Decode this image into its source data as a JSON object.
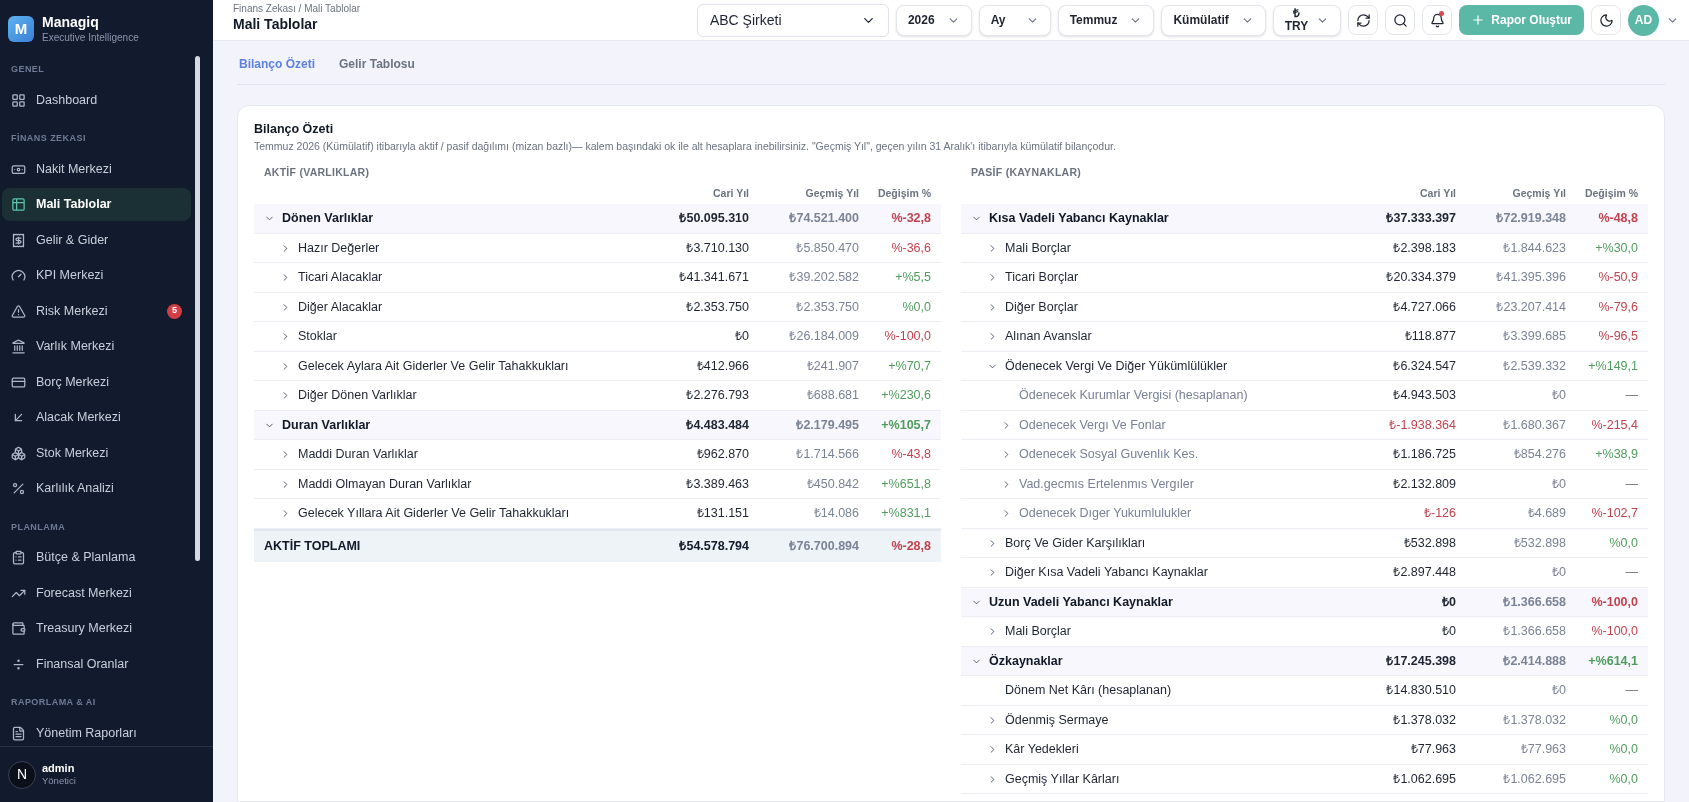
{
  "brand": {
    "logo_letter": "M",
    "name": "Managiq",
    "tagline": "Executive Intelligence"
  },
  "sidebar": {
    "sections": [
      {
        "label": "GENEL",
        "items": [
          {
            "label": "Dashboard",
            "selected": false
          }
        ]
      },
      {
        "label": "FİNANS ZEKASI",
        "items": [
          {
            "label": "Nakit Merkezi",
            "selected": false
          },
          {
            "label": "Mali Tablolar",
            "selected": true
          },
          {
            "label": "Gelir & Gider",
            "selected": false
          },
          {
            "label": "KPI Merkezi",
            "selected": false
          },
          {
            "label": "Risk Merkezi",
            "selected": false,
            "badge": "5"
          },
          {
            "label": "Varlık Merkezi",
            "selected": false
          },
          {
            "label": "Borç Merkezi",
            "selected": false
          },
          {
            "label": "Alacak Merkezi",
            "selected": false
          },
          {
            "label": "Stok Merkezi",
            "selected": false
          },
          {
            "label": "Karlılık Analizi",
            "selected": false
          }
        ]
      },
      {
        "label": "PLANLAMA",
        "items": [
          {
            "label": "Bütçe & Planlama",
            "selected": false
          },
          {
            "label": "Forecast Merkezi",
            "selected": false
          },
          {
            "label": "Treasury Merkezi",
            "selected": false
          },
          {
            "label": "Finansal Oranlar",
            "selected": false
          }
        ]
      },
      {
        "label": "RAPORLAMA & AI",
        "items": [
          {
            "label": "Yönetim Raporları",
            "selected": false
          }
        ]
      }
    ]
  },
  "user": {
    "initial": "N",
    "name": "admin",
    "role": "Yönetici"
  },
  "header": {
    "breadcrumb": "Finans Zekası / Mali Tablolar",
    "title": "Mali Tablolar",
    "filters": [
      {
        "kind": "wide",
        "value": "ABC Şirketi"
      },
      {
        "kind": "pill",
        "value": "2026"
      },
      {
        "kind": "pill",
        "value": "Ay"
      },
      {
        "kind": "pill",
        "value": "Temmuz"
      },
      {
        "kind": "pill",
        "value": "Kümülatif"
      },
      {
        "kind": "currency",
        "symbol": "₺",
        "value": "TRY"
      }
    ],
    "notification_dot": true,
    "create_button": "Rapor Oluştur",
    "avatar": "AD"
  },
  "tabs": [
    {
      "label": "Bilanço Özeti",
      "selected": true
    },
    {
      "label": "Gelir Tablosu",
      "selected": false
    }
  ],
  "card": {
    "title": "Bilanço Özeti",
    "description": "Temmuz 2026 (Kümülatif) itibarıyla aktif / pasif dağılımı (mizan bazlı)— kalem başındaki ok ile alt hesaplara inebilirsiniz. \"Geçmiş Yıl\", geçen yılın 31 Aralık'ı itibarıyla kümülatif bilançodur.",
    "panels": [
      {
        "heading": "AKTİF (VARLIKLAR)",
        "columns": [
          "Cari Yıl",
          "Geçmiş Yıl",
          "Değişim %"
        ],
        "rows": [
          {
            "label": "Dönen Varlıklar",
            "expanded": true,
            "current": "₺50.095.310",
            "negative_current": false,
            "previous": "₺74.521.400",
            "change": "%-32,8",
            "decline": true,
            "comparable": true,
            "children": [
              {
                "label": "Hazır Değerler",
                "expanded": false,
                "current": "₺3.710.130",
                "negative_current": false,
                "previous": "₺5.850.470",
                "change": "%-36,6",
                "decline": true,
                "comparable": true
              },
              {
                "label": "Ticari Alacaklar",
                "expanded": false,
                "current": "₺41.341.671",
                "negative_current": false,
                "previous": "₺39.202.582",
                "change": "+%5,5",
                "decline": false,
                "comparable": true
              },
              {
                "label": "Diğer Alacaklar",
                "expanded": false,
                "current": "₺2.353.750",
                "negative_current": false,
                "previous": "₺2.353.750",
                "change": "%0,0",
                "decline": false,
                "comparable": true
              },
              {
                "label": "Stoklar",
                "expanded": false,
                "current": "₺0",
                "negative_current": false,
                "previous": "₺26.184.009",
                "change": "%-100,0",
                "decline": true,
                "comparable": true
              },
              {
                "label": "Gelecek Aylara Ait Giderler Ve Gelir Tahakkukları",
                "expanded": false,
                "current": "₺412.966",
                "negative_current": false,
                "previous": "₺241.907",
                "change": "+%70,7",
                "decline": false,
                "comparable": true
              },
              {
                "label": "Diğer Dönen Varlıklar",
                "expanded": false,
                "current": "₺2.276.793",
                "negative_current": false,
                "previous": "₺688.681",
                "change": "+%230,6",
                "decline": false,
                "comparable": true
              }
            ]
          },
          {
            "label": "Duran Varlıklar",
            "expanded": true,
            "current": "₺4.483.484",
            "negative_current": false,
            "previous": "₺2.179.495",
            "change": "+%105,7",
            "decline": false,
            "comparable": true,
            "children": [
              {
                "label": "Maddi Duran Varlıklar",
                "expanded": false,
                "current": "₺962.870",
                "negative_current": false,
                "previous": "₺1.714.566",
                "change": "%-43,8",
                "decline": true,
                "comparable": true
              },
              {
                "label": "Maddi Olmayan Duran Varlıklar",
                "expanded": false,
                "current": "₺3.389.463",
                "negative_current": false,
                "previous": "₺450.842",
                "change": "+%651,8",
                "decline": false,
                "comparable": true
              },
              {
                "label": "Gelecek Yıllara Ait Giderler Ve Gelir Tahakkukları",
                "expanded": false,
                "current": "₺131.151",
                "negative_current": false,
                "previous": "₺14.086",
                "change": "+%831,1",
                "decline": false,
                "comparable": true
              }
            ]
          }
        ],
        "total": {
          "label": "AKTİF TOPLAMI",
          "current": "₺54.578.794",
          "previous": "₺76.700.894",
          "change": "%-28,8",
          "decline": true
        }
      },
      {
        "heading": "PASİF (KAYNAKLAR)",
        "columns": [
          "Cari Yıl",
          "Geçmiş Yıl",
          "Değişim %"
        ],
        "rows": [
          {
            "label": "Kısa Vadeli Yabancı Kaynaklar",
            "expanded": true,
            "current": "₺37.333.397",
            "negative_current": false,
            "previous": "₺72.919.348",
            "change": "%-48,8",
            "decline": true,
            "comparable": true,
            "children": [
              {
                "label": "Mali Borçlar",
                "expanded": false,
                "current": "₺2.398.183",
                "negative_current": false,
                "previous": "₺1.844.623",
                "change": "+%30,0",
                "decline": false,
                "comparable": true
              },
              {
                "label": "Ticari Borçlar",
                "expanded": false,
                "current": "₺20.334.379",
                "negative_current": false,
                "previous": "₺41.395.396",
                "change": "%-50,9",
                "decline": true,
                "comparable": true
              },
              {
                "label": "Diğer Borçlar",
                "expanded": false,
                "current": "₺4.727.066",
                "negative_current": false,
                "previous": "₺23.207.414",
                "change": "%-79,6",
                "decline": true,
                "comparable": true
              },
              {
                "label": "Alınan Avanslar",
                "expanded": false,
                "current": "₺118.877",
                "negative_current": false,
                "previous": "₺3.399.685",
                "change": "%-96,5",
                "decline": true,
                "comparable": true
              },
              {
                "label": "Ödenecek Vergi Ve Diğer Yükümlülükler",
                "expanded": true,
                "current": "₺6.324.547",
                "negative_current": false,
                "previous": "₺2.539.332",
                "change": "+%149,1",
                "decline": false,
                "comparable": true,
                "children": [
                  {
                    "label": "Ödenecek Kurumlar Vergisi (hesaplanan)",
                    "current": "₺4.943.503",
                    "negative_current": false,
                    "previous": "₺0",
                    "change": "—",
                    "decline": false,
                    "comparable": false
                  },
                  {
                    "label": "Odenecek Vergı Ve Fonlar",
                    "expanded": false,
                    "current": "₺-1.938.364",
                    "negative_current": true,
                    "previous": "₺1.680.367",
                    "change": "%-215,4",
                    "decline": true,
                    "comparable": true
                  },
                  {
                    "label": "Odenecek Sosyal Guvenlık Kes.",
                    "expanded": false,
                    "current": "₺1.186.725",
                    "negative_current": false,
                    "previous": "₺854.276",
                    "change": "+%38,9",
                    "decline": false,
                    "comparable": true
                  },
                  {
                    "label": "Vad.gecmıs Ertelenmıs Vergıler",
                    "expanded": false,
                    "current": "₺2.132.809",
                    "negative_current": false,
                    "previous": "₺0",
                    "change": "—",
                    "decline": false,
                    "comparable": false
                  },
                  {
                    "label": "Odenecek Dıger Yukumlulukler",
                    "expanded": false,
                    "current": "₺-126",
                    "negative_current": true,
                    "previous": "₺4.689",
                    "change": "%-102,7",
                    "decline": true,
                    "comparable": true
                  }
                ]
              },
              {
                "label": "Borç Ve Gider Karşılıkları",
                "expanded": false,
                "current": "₺532.898",
                "negative_current": false,
                "previous": "₺532.898",
                "change": "%0,0",
                "decline": false,
                "comparable": true
              },
              {
                "label": "Diğer Kısa Vadeli Yabancı Kaynaklar",
                "expanded": false,
                "current": "₺2.897.448",
                "negative_current": false,
                "previous": "₺0",
                "change": "—",
                "decline": false,
                "comparable": false
              }
            ]
          },
          {
            "label": "Uzun Vadeli Yabancı Kaynaklar",
            "expanded": true,
            "current": "₺0",
            "negative_current": false,
            "previous": "₺1.366.658",
            "change": "%-100,0",
            "decline": true,
            "comparable": true,
            "children": [
              {
                "label": "Mali Borçlar",
                "expanded": false,
                "current": "₺0",
                "negative_current": false,
                "previous": "₺1.366.658",
                "change": "%-100,0",
                "decline": true,
                "comparable": true
              }
            ]
          },
          {
            "label": "Özkaynaklar",
            "expanded": true,
            "current": "₺17.245.398",
            "negative_current": false,
            "previous": "₺2.414.888",
            "change": "+%614,1",
            "decline": false,
            "comparable": true,
            "children": [
              {
                "label": "Dönem Net Kârı (hesaplanan)",
                "current": "₺14.830.510",
                "negative_current": false,
                "previous": "₺0",
                "change": "—",
                "decline": false,
                "comparable": false
              },
              {
                "label": "Ödenmiş Sermaye",
                "expanded": false,
                "current": "₺1.378.032",
                "negative_current": false,
                "previous": "₺1.378.032",
                "change": "%0,0",
                "decline": false,
                "comparable": true
              },
              {
                "label": "Kâr Yedekleri",
                "expanded": false,
                "current": "₺77.963",
                "negative_current": false,
                "previous": "₺77.963",
                "change": "%0,0",
                "decline": false,
                "comparable": true
              },
              {
                "label": "Geçmiş Yıllar Kârları",
                "expanded": false,
                "current": "₺1.062.695",
                "negative_current": false,
                "previous": "₺1.062.695",
                "change": "%0,0",
                "decline": false,
                "comparable": true
              }
            ]
          }
        ]
      }
    ]
  }
}
